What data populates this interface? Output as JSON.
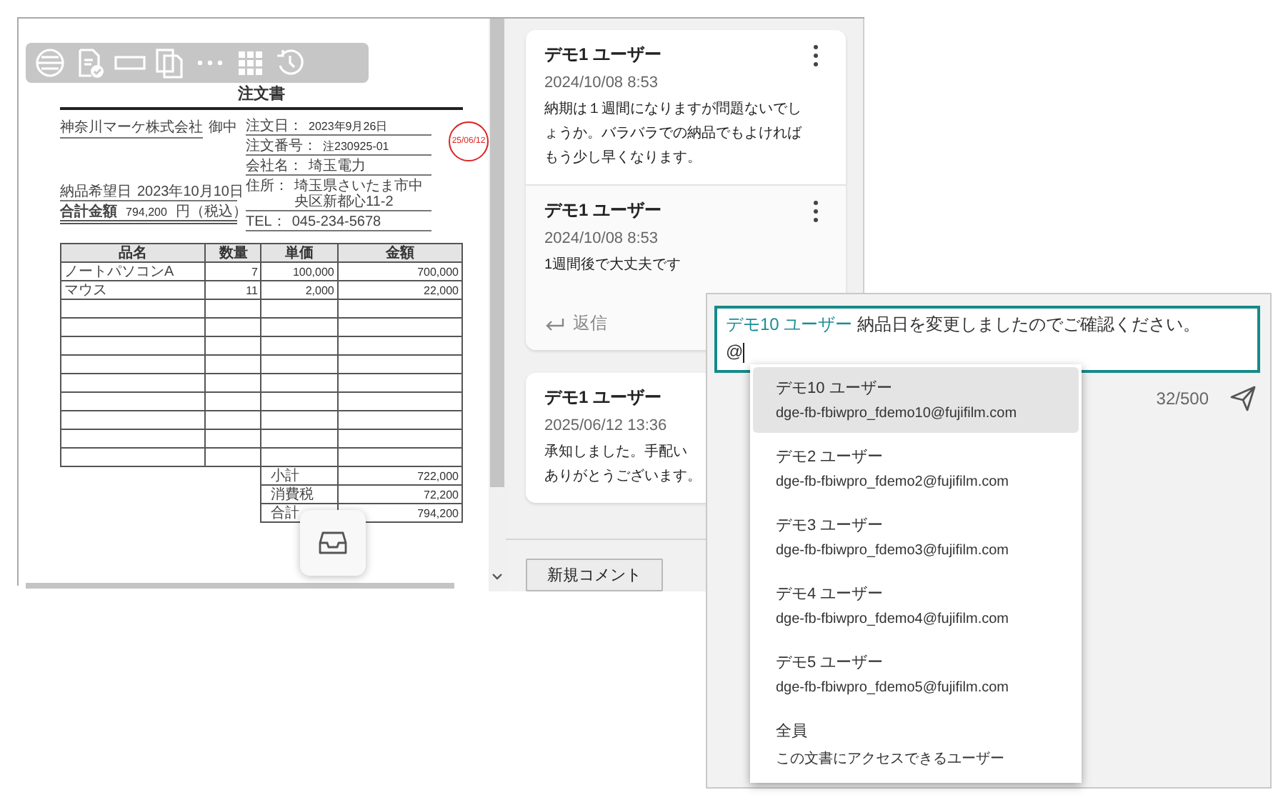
{
  "viewer": {
    "document": {
      "title": "注文書",
      "recipient": {
        "name": "神奈川マーケ株式会社",
        "honorific": "御中"
      },
      "order_fields": [
        {
          "label": "注文日：",
          "value": "2023年9月26日"
        },
        {
          "label": "注文番号：",
          "value": "注230925-01"
        }
      ],
      "stamp": {
        "date": "25/06/12"
      },
      "delivery": {
        "label": "納品希望日",
        "value": "2023年10月10日"
      },
      "total": {
        "label": "合計金額",
        "value": "794,200",
        "unit": "円（税込）"
      },
      "supplier_fields": [
        {
          "label": "会社名：",
          "value": "埼玉電力"
        },
        {
          "label": "住所：",
          "value": "埼玉県さいたま市中央区新都心11-2"
        },
        {
          "label": "TEL：",
          "value": "045-234-5678"
        }
      ],
      "table": {
        "columns": [
          "品名",
          "数量",
          "単価",
          "金額"
        ],
        "rows": [
          [
            "ノートパソコンA",
            "7",
            "100,000",
            "700,000"
          ],
          [
            "マウス",
            "11",
            "2,000",
            "22,000"
          ]
        ]
      },
      "summary": [
        {
          "label": "小計",
          "value": "722,000"
        },
        {
          "label": "消費税",
          "value": "72,200"
        },
        {
          "label": "合計",
          "value": "794,200"
        }
      ]
    }
  },
  "threads": [
    {
      "comments": [
        {
          "author": "デモ1 ユーザー",
          "date": "2024/10/08 8:53",
          "lines": [
            "納期は１週間になりますが問題ないでしょうか。バラバラでの納品でもよければもう少し早くなります。"
          ],
          "menu": true
        },
        {
          "author": "デモ1 ユーザー",
          "date": "2024/10/08 8:53",
          "lines": [
            "1週間後で大丈夫です"
          ],
          "menu": true
        }
      ],
      "reply": "返信"
    },
    {
      "comments": [
        {
          "author": "デモ1 ユーザー",
          "date": "2025/06/12 13:36",
          "lines": [
            "承知しました。手配い",
            "ありがとうございます。"
          ],
          "menu": false
        }
      ]
    }
  ],
  "new_comment_button": "新規コメント",
  "composer": {
    "mention": "デモ10 ユーザー",
    "text": "納品日を変更しましたのでご確認ください。",
    "typed": "@",
    "counter": "32/500"
  },
  "mention_menu": [
    {
      "name": "デモ10 ユーザー",
      "detail": "dge-fb-fbiwpro_fdemo10@fujifilm.com",
      "selected": true
    },
    {
      "name": "デモ2 ユーザー",
      "detail": "dge-fb-fbiwpro_fdemo2@fujifilm.com",
      "selected": false
    },
    {
      "name": "デモ3 ユーザー",
      "detail": "dge-fb-fbiwpro_fdemo3@fujifilm.com",
      "selected": false
    },
    {
      "name": "デモ4 ユーザー",
      "detail": "dge-fb-fbiwpro_fdemo4@fujifilm.com",
      "selected": false
    },
    {
      "name": "デモ5 ユーザー",
      "detail": "dge-fb-fbiwpro_fdemo5@fujifilm.com",
      "selected": false
    },
    {
      "name": "全員",
      "detail": "この文書にアクセスできるユーザー",
      "selected": false
    }
  ]
}
